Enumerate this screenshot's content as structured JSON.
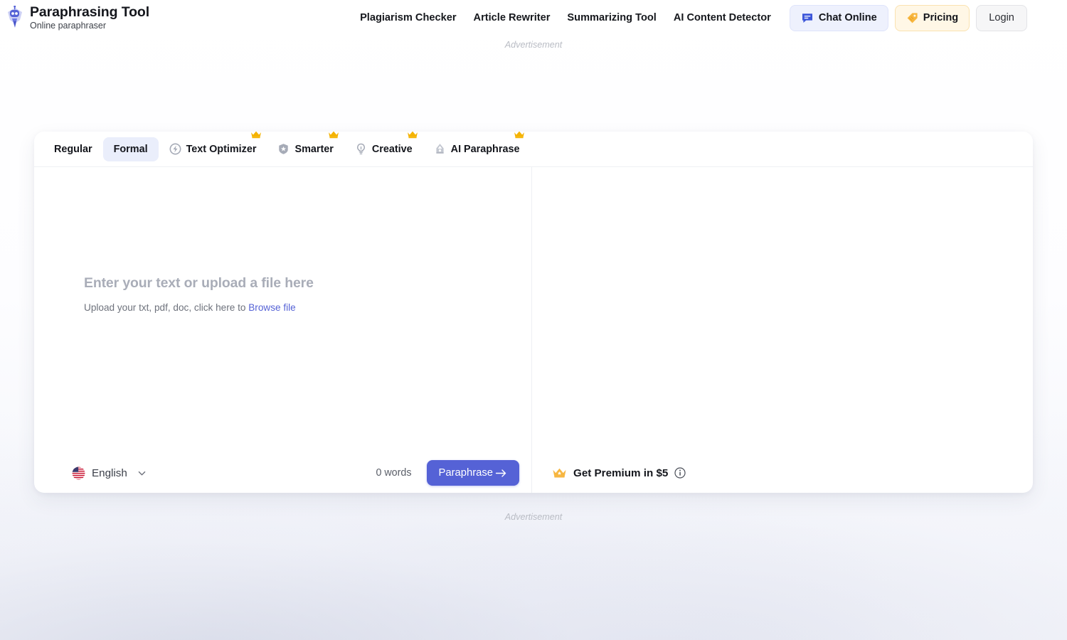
{
  "brand": {
    "title": "Paraphrasing Tool",
    "subtitle": "Online paraphraser",
    "logo_icon": "robot-pen-logo"
  },
  "nav": {
    "links": [
      {
        "label": "Plagiarism Checker"
      },
      {
        "label": "Article Rewriter"
      },
      {
        "label": "Summarizing Tool"
      },
      {
        "label": "AI Content Detector"
      }
    ],
    "chat_button": {
      "label": "Chat Online",
      "icon": "chat-bubble-icon",
      "bg": "#eef1fd",
      "icon_color": "#3b55d9"
    },
    "pricing_button": {
      "label": "Pricing",
      "icon": "price-tag-icon",
      "bg": "#fff7e6",
      "icon_color": "#f5a623"
    },
    "login_button": {
      "label": "Login",
      "bg": "#f6f6f7"
    }
  },
  "ads": {
    "top_label": "Advertisement",
    "bottom_label": "Advertisement"
  },
  "modes": {
    "tabs": [
      {
        "label": "Regular",
        "icon": null,
        "premium": false,
        "selected": false
      },
      {
        "label": "Formal",
        "icon": null,
        "premium": false,
        "selected": true
      },
      {
        "label": "Text Optimizer",
        "icon": "lightning-circle-icon",
        "premium": true,
        "selected": false
      },
      {
        "label": "Smarter",
        "icon": "star-shield-icon",
        "premium": true,
        "selected": false
      },
      {
        "label": "Creative",
        "icon": "lightbulb-icon",
        "premium": true,
        "selected": false
      },
      {
        "label": "AI Paraphrase",
        "icon": "pen-nib-icon",
        "premium": true,
        "selected": false
      }
    ],
    "crown_color": "#f5b301"
  },
  "editor": {
    "placeholder_title": "Enter your text or upload a file here",
    "upload_hint": "Upload your txt, pdf, doc, click here to",
    "browse_link": "Browse file",
    "input_value": "",
    "output_value": ""
  },
  "footer": {
    "language": {
      "name": "English",
      "flag": "us-flag-icon",
      "chevron": "chevron-down-icon"
    },
    "word_count": "0 words",
    "paraphrase_button": {
      "label": "Paraphrase",
      "icon": "arrow-right-icon",
      "color": "#5562d6"
    },
    "premium": {
      "label": "Get Premium in $5",
      "crown": "crown-icon",
      "info": "info-circle-icon"
    }
  },
  "colors": {
    "accent": "#5562d6",
    "tab_selected_bg": "#eaeefb",
    "crown_gold": "#f5b301",
    "link": "#5562d6"
  }
}
